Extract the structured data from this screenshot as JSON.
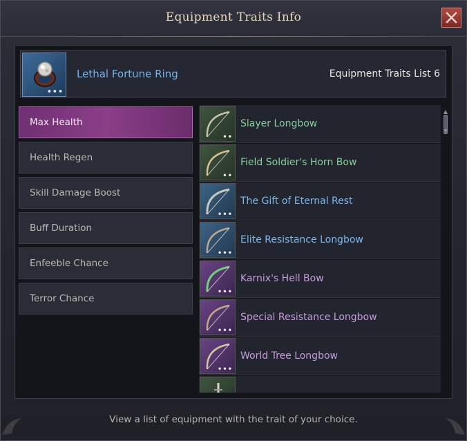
{
  "window": {
    "title": "Equipment Traits Info",
    "close_icon": "close-icon"
  },
  "selected_item": {
    "name": "Lethal Fortune Ring",
    "icon": "ring-icon",
    "traits_label": "Equipment Traits List 6"
  },
  "traits": [
    {
      "label": "Max Health",
      "active": true
    },
    {
      "label": "Health Regen",
      "active": false
    },
    {
      "label": "Skill Damage Boost",
      "active": false
    },
    {
      "label": "Buff Duration",
      "active": false
    },
    {
      "label": "Enfeeble Chance",
      "active": false
    },
    {
      "label": "Terror Chance",
      "active": false
    }
  ],
  "equipment": [
    {
      "name": "Slayer Longbow",
      "grade": "green",
      "icon": "longbow-icon",
      "dots": "••"
    },
    {
      "name": "Field Soldier's Horn Bow",
      "grade": "green",
      "icon": "longbow-icon",
      "dots": "••"
    },
    {
      "name": "The Gift of Eternal Rest",
      "grade": "blue",
      "icon": "longbow-icon",
      "dots": "•••"
    },
    {
      "name": "Elite Resistance Longbow",
      "grade": "blue",
      "icon": "longbow-icon",
      "dots": "•••"
    },
    {
      "name": "Karnix's Hell Bow",
      "grade": "purple",
      "icon": "longbow-icon",
      "dots": "•••"
    },
    {
      "name": "Special Resistance Longbow",
      "grade": "purple",
      "icon": "longbow-icon",
      "dots": "•••"
    },
    {
      "name": "World Tree Longbow",
      "grade": "purple",
      "icon": "longbow-icon",
      "dots": "•••"
    },
    {
      "name": "",
      "grade": "green",
      "icon": "dagger-icon",
      "dots": ""
    }
  ],
  "footer": {
    "text": "View a list of equipment with the trait of your choice."
  },
  "colors": {
    "accent_active": "#8a3f86",
    "grade_green": "#84d09a",
    "grade_blue": "#79b9ee",
    "grade_purple": "#c79ae0",
    "title": "#e9d9b8",
    "close_button": "#9e3b33"
  }
}
